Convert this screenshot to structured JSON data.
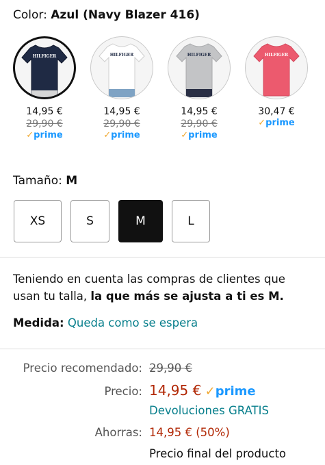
{
  "color": {
    "label": "Color:",
    "value": "Azul (Navy Blazer 416)"
  },
  "swatches": [
    {
      "name": "navy",
      "shirt_color": "#1f2a44",
      "price": "14,95 €",
      "old_price": "29,90 €",
      "prime": "prime",
      "selected": true
    },
    {
      "name": "white",
      "shirt_color": "#ffffff",
      "price": "14,95 €",
      "old_price": "29,90 €",
      "prime": "prime",
      "selected": false
    },
    {
      "name": "grey",
      "shirt_color": "#c3c4c6",
      "price": "14,95 €",
      "old_price": "29,90 €",
      "prime": "prime",
      "selected": false
    },
    {
      "name": "pink",
      "shirt_color": "#ec5a6e",
      "price": "30,47 €",
      "old_price": "",
      "prime": "prime",
      "selected": false
    }
  ],
  "logo_text": "HILFIGER",
  "size": {
    "label": "Tamaño:",
    "value": "M",
    "options": [
      "XS",
      "S",
      "M",
      "L"
    ],
    "selected": "M"
  },
  "fit": {
    "text_prefix": "Teniendo en cuenta las compras de clientes que usan tu talla, ",
    "text_bold": "la que más se ajusta a ti es M.",
    "measure_label": "Medida:",
    "measure_value": "Queda como se espera"
  },
  "pricing": {
    "rec_label": "Precio recomendado:",
    "rec_value": "29,90 €",
    "price_label": "Precio:",
    "price_value": "14,95 €",
    "prime": "prime",
    "returns": "Devoluciones GRATIS",
    "save_label": "Ahorras:",
    "save_value": "14,95 € (50%)",
    "final": "Precio final del producto"
  },
  "colors": {
    "accent_red": "#b12704",
    "link_teal": "#087f8c",
    "prime_blue": "#1a98ff",
    "selected_size_bg": "#111111"
  }
}
